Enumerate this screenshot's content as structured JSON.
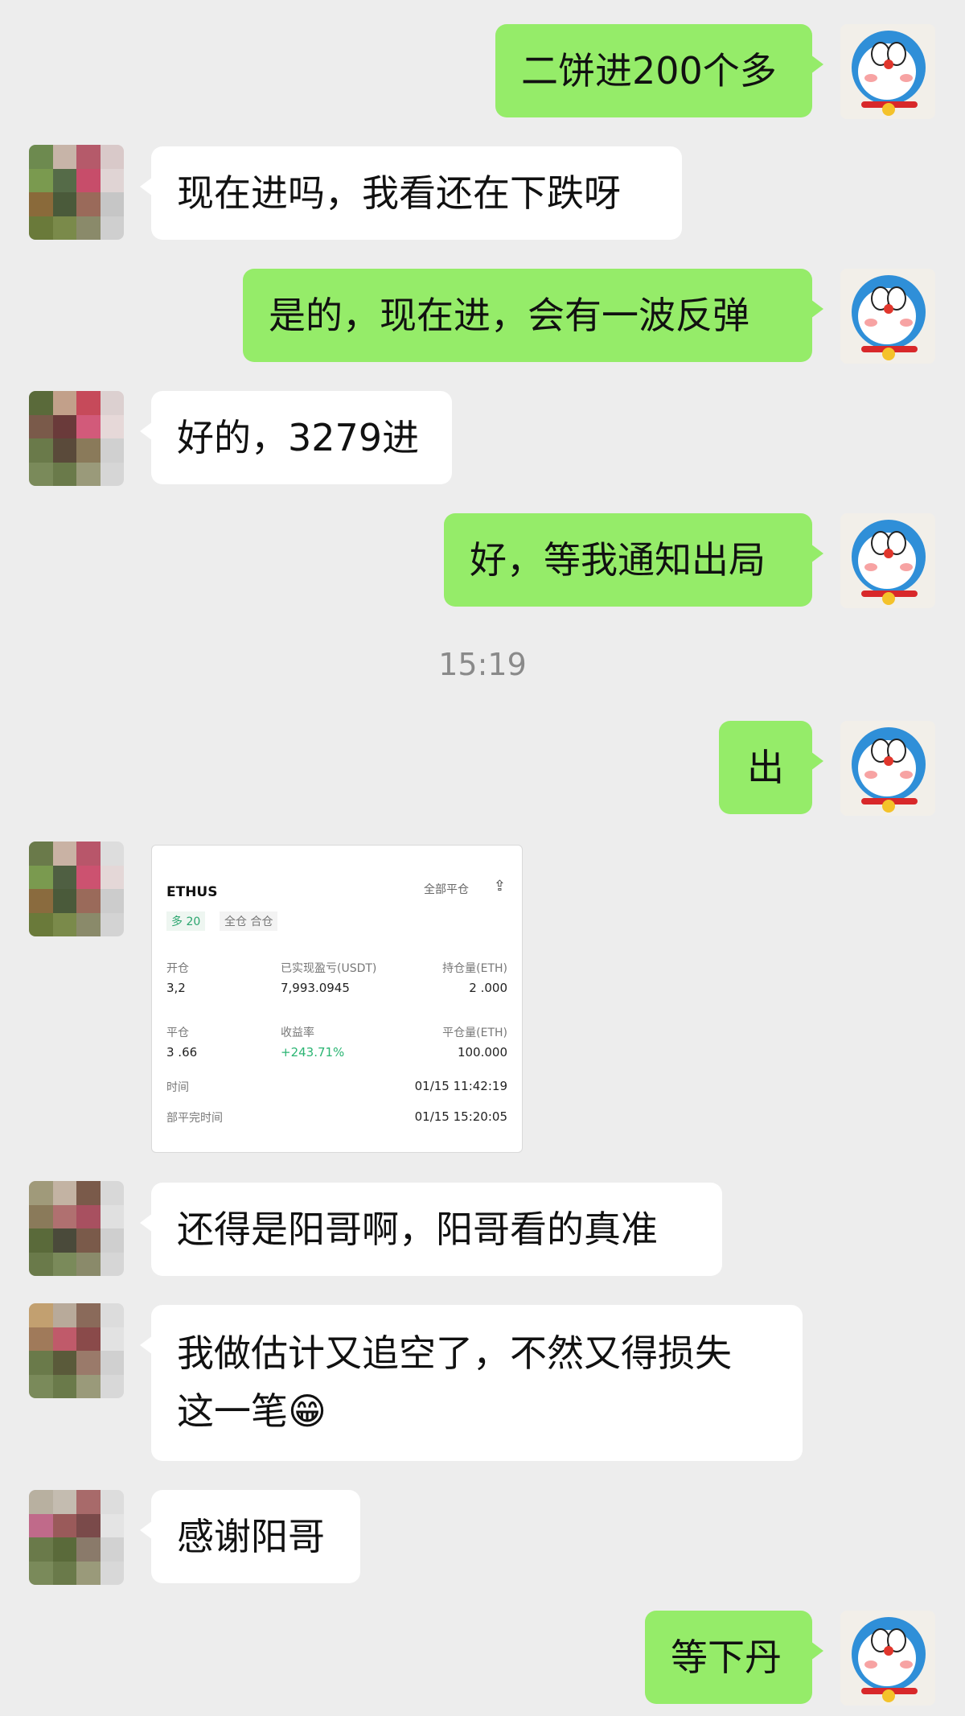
{
  "messages": [
    {
      "side": "me",
      "text": "二饼进200个多"
    },
    {
      "side": "other",
      "text": "现在进吗，我看还在下跌呀"
    },
    {
      "side": "me",
      "text": "是的，现在进，会有一波反弹"
    },
    {
      "side": "other",
      "text": "好的，3279进"
    },
    {
      "side": "me",
      "text": "好，等我通知出局"
    },
    {
      "side": "me",
      "text": "出"
    },
    {
      "side": "other",
      "text": "还得是阳哥啊，阳哥看的真准"
    },
    {
      "side": "other",
      "text_line1": "我做估计又追空了，不然又得损失",
      "text_line2": "这一笔😁"
    },
    {
      "side": "other",
      "text": "感谢阳哥"
    },
    {
      "side": "me",
      "text": "等下丹"
    }
  ],
  "timestamp": "15:19",
  "trade_card": {
    "symbol": "ETHUS",
    "close_all": "全部平仓",
    "share_icon": "share-icon",
    "tag_long": "多 20",
    "tag_mode": "全仓 合仓",
    "open_label": "开仓",
    "open_value": "3,2",
    "realized_label": "已实现盈亏(USDT)",
    "realized_value": "7,993.0945",
    "position_label": "持仓量(ETH)",
    "position_value": "2   .000",
    "close_label": "平仓",
    "close_value": "3    .66",
    "yield_label": "收益率",
    "yield_value": "+243.71%",
    "closed_label": "平仓量(ETH)",
    "closed_value": "100.000",
    "open_time_label": "时间",
    "open_time_value": "01/15 11:42:19",
    "full_close_time_label": "部平完时间",
    "full_close_time_value": "01/15 15:20:05"
  },
  "colors": {
    "me_bubble": "#95ec69",
    "other_bubble": "#ffffff",
    "background": "#ededed",
    "profit": "#2bb573"
  }
}
